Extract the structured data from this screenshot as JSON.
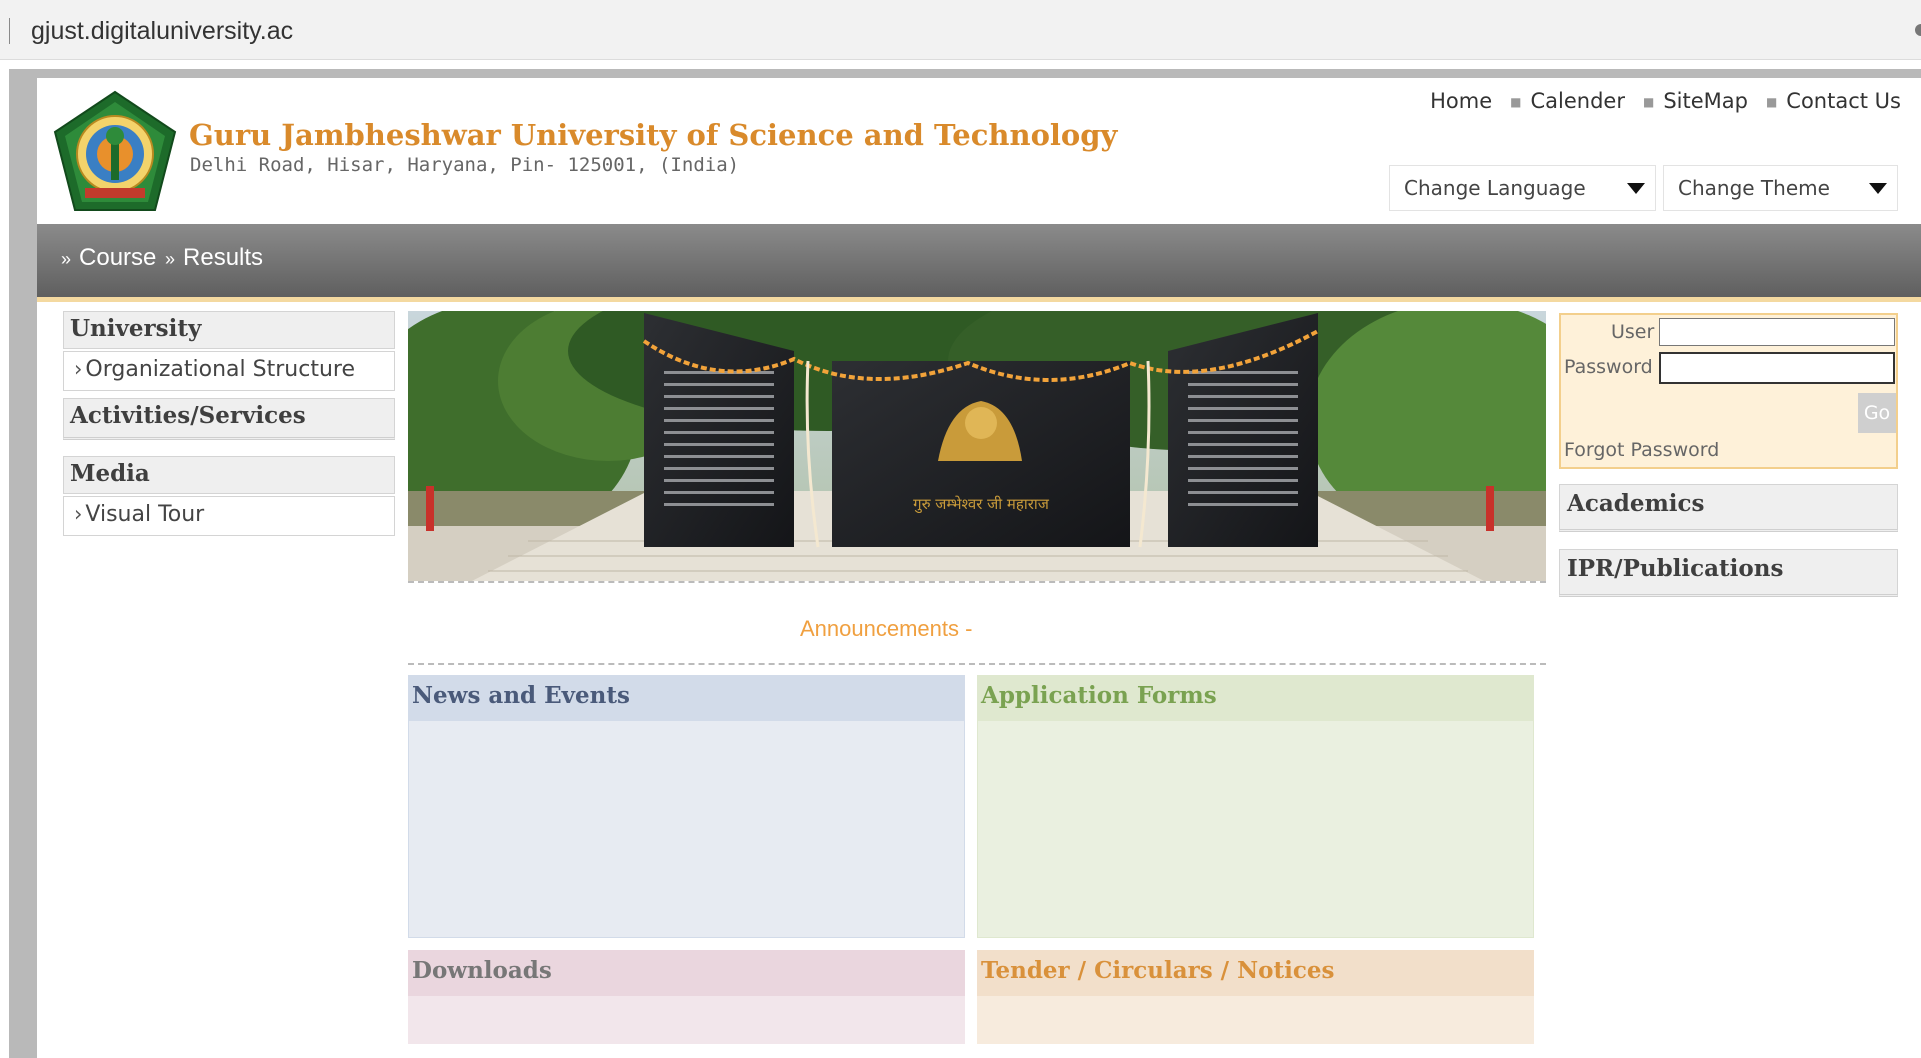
{
  "browser": {
    "url": "gjust.digitaluniversity.ac"
  },
  "header": {
    "title": "Guru Jambheshwar University of Science and Technology",
    "address": "Delhi Road, Hisar, Haryana, Pin- 125001, (India)",
    "top_links": [
      "Home",
      "Calender",
      "SiteMap",
      "Contact Us"
    ],
    "language_select": "Change Language",
    "theme_select": "Change Theme"
  },
  "navbar": {
    "items": [
      "Course",
      "Results"
    ]
  },
  "left_sidebar": {
    "university_head": "University",
    "org_structure": "Organizational Structure",
    "activities_head": "Activities/Services",
    "media_head": "Media",
    "visual_tour": "Visual Tour"
  },
  "banner": {
    "plaque_text": "गुरु जम्भेश्वर जी महाराज"
  },
  "announcements": "Announcements -",
  "panels": {
    "news": "News and Events",
    "forms": "Application Forms",
    "downloads": "Downloads",
    "tender": "Tender / Circulars / Notices"
  },
  "login": {
    "user_label": "User",
    "password_label": "Password",
    "go_label": "Go",
    "forgot_label": "Forgot Password"
  },
  "right_sidebar": {
    "academics": "Academics",
    "ipr": "IPR/Publications"
  },
  "colors": {
    "title_orange": "#d98a2b",
    "nav_gray": "#6e6e6e",
    "login_bg": "#fef1d9"
  }
}
